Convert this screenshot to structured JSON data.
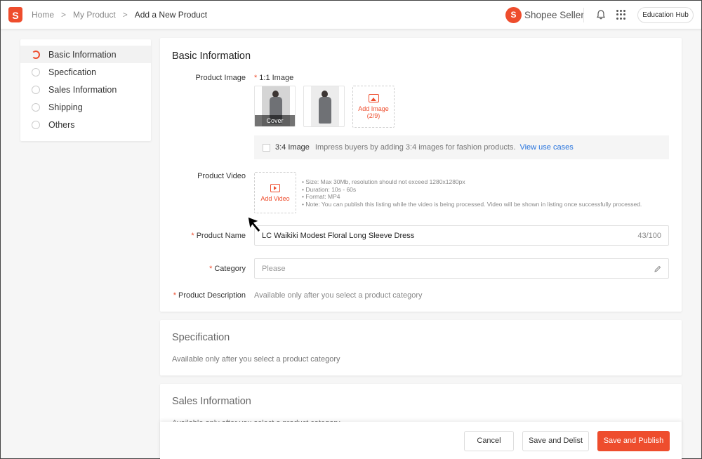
{
  "breadcrumb": {
    "home": "Home",
    "my_product": "My Product",
    "current": "Add a New Product"
  },
  "logo": {
    "letter": "S"
  },
  "brand": {
    "letter": "S",
    "name": "Shopee Seller"
  },
  "header": {
    "education_hub": "Education Hub"
  },
  "sidebar": {
    "items": [
      {
        "label": "Basic Information",
        "active": true
      },
      {
        "label": "Specfication",
        "active": false
      },
      {
        "label": "Sales Information",
        "active": false
      },
      {
        "label": "Shipping",
        "active": false
      },
      {
        "label": "Others",
        "active": false
      }
    ]
  },
  "basic_info": {
    "title": "Basic Information",
    "product_image": {
      "label": "Product Image",
      "ratio_label": "1:1 Image",
      "cover_label": "Cover",
      "add_image_label": "Add Image",
      "add_image_count": "(2/9)"
    },
    "fashion": {
      "label": "3:4 Image",
      "desc": "Impress buyers by adding 3:4 images for fashion products.",
      "link": "View use cases"
    },
    "product_video": {
      "label": "Product Video",
      "add_label": "Add Video",
      "notes": [
        "Size: Max 30Mb, resolution should not exceed 1280x1280px",
        "Duration: 10s - 60s",
        "Format: MP4",
        "Note: You can publish this listing while the video is being processed. Video will be shown in listing once successfully processed."
      ]
    },
    "product_name": {
      "label": "Product Name",
      "value": "LC Waikiki Modest Floral Long Sleeve Dress",
      "count": "43/100"
    },
    "category": {
      "label": "Category",
      "placeholder": "Please"
    },
    "description": {
      "label": "Product Description",
      "hint": "Available only after you select a product category"
    }
  },
  "specification": {
    "title": "Specification",
    "hint": "Available only after you select a product category"
  },
  "sales_info": {
    "title": "Sales Information",
    "hint": "Available only after you select a product category"
  },
  "actions": {
    "cancel": "Cancel",
    "save_delist": "Save and Delist",
    "save_publish": "Save and Publish"
  },
  "colors": {
    "accent": "#ee4d2d",
    "link": "#2673dd"
  }
}
